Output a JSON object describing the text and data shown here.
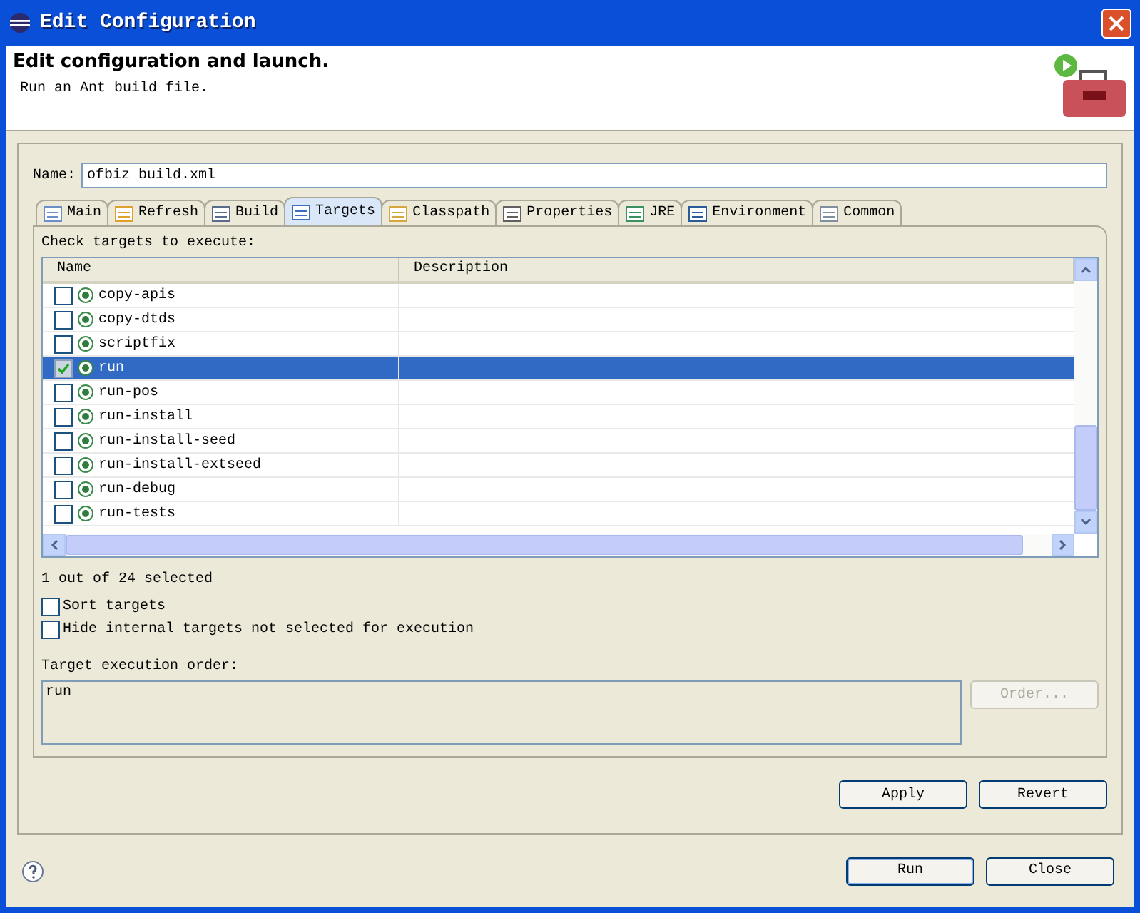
{
  "window": {
    "title": "Edit Configuration"
  },
  "header": {
    "title": "Edit configuration and launch.",
    "subtitle": "Run an Ant build file."
  },
  "name_field": {
    "label": "Name:",
    "value": "ofbiz build.xml"
  },
  "tabs": [
    {
      "label": "Main",
      "selected": false
    },
    {
      "label": "Refresh",
      "selected": false
    },
    {
      "label": "Build",
      "selected": false
    },
    {
      "label": "Targets",
      "selected": true
    },
    {
      "label": "Classpath",
      "selected": false
    },
    {
      "label": "Properties",
      "selected": false
    },
    {
      "label": "JRE",
      "selected": false
    },
    {
      "label": "Environment",
      "selected": false
    },
    {
      "label": "Common",
      "selected": false
    }
  ],
  "targets": {
    "label": "Check targets to execute:",
    "columns": [
      "Name",
      "Description"
    ],
    "rows": [
      {
        "name": "copy-apis",
        "checked": false,
        "selected": false
      },
      {
        "name": "copy-dtds",
        "checked": false,
        "selected": false
      },
      {
        "name": "scriptfix",
        "checked": false,
        "selected": false
      },
      {
        "name": "run",
        "checked": true,
        "selected": true
      },
      {
        "name": "run-pos",
        "checked": false,
        "selected": false
      },
      {
        "name": "run-install",
        "checked": false,
        "selected": false
      },
      {
        "name": "run-install-seed",
        "checked": false,
        "selected": false
      },
      {
        "name": "run-install-extseed",
        "checked": false,
        "selected": false
      },
      {
        "name": "run-debug",
        "checked": false,
        "selected": false
      },
      {
        "name": "run-tests",
        "checked": false,
        "selected": false
      }
    ],
    "summary": "1 out of 24 selected"
  },
  "options": [
    {
      "label": "Sort targets",
      "checked": false
    },
    {
      "label": "Hide internal targets not selected for execution",
      "checked": false
    }
  ],
  "execution_order": {
    "label": "Target execution order:",
    "value": "run",
    "order_button": {
      "label": "Order...",
      "disabled": true
    }
  },
  "panel_buttons": [
    "Apply",
    "Revert"
  ],
  "dialog_buttons": [
    {
      "label": "Run",
      "default": true
    },
    {
      "label": "Close",
      "default": false
    }
  ]
}
